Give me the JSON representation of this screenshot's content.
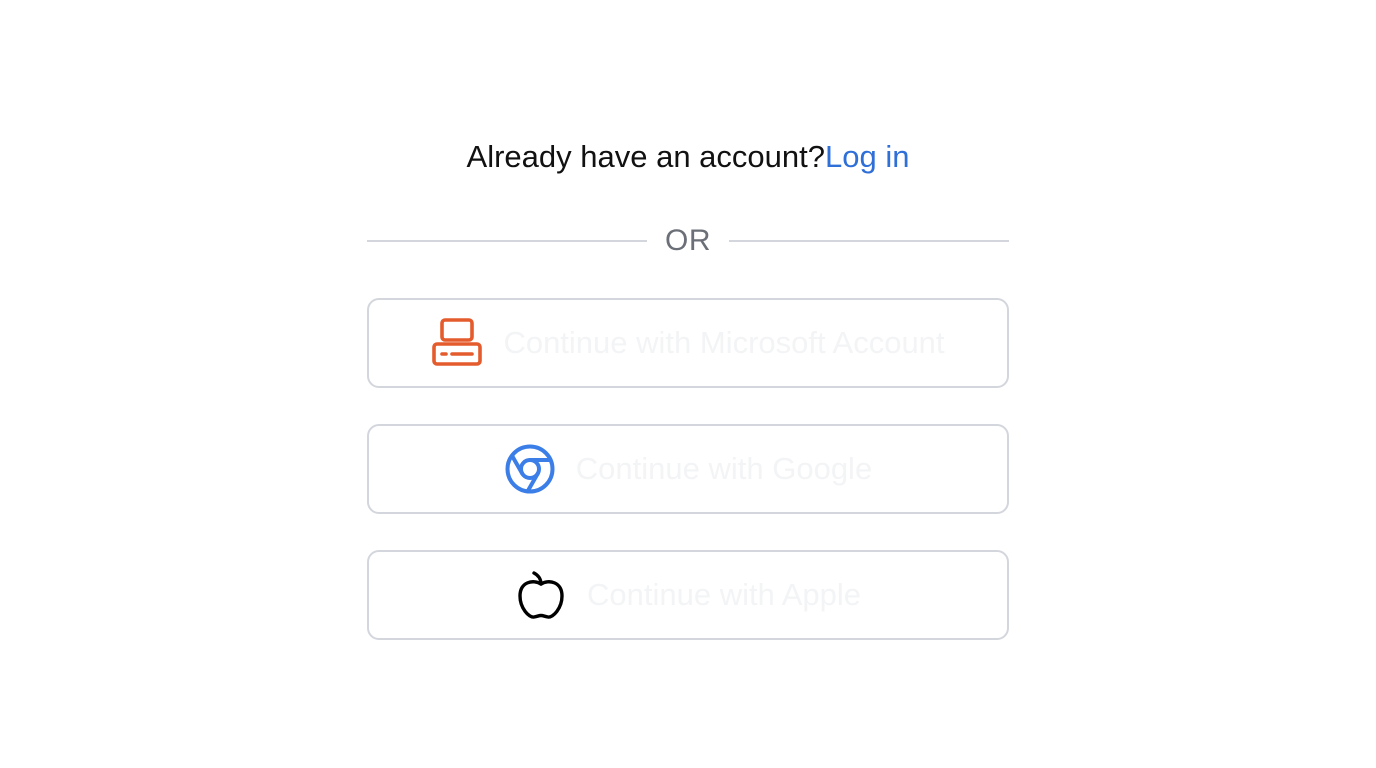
{
  "prompt": {
    "text": "Already have an account?",
    "link_label": "Log in"
  },
  "divider": {
    "label": "OR"
  },
  "buttons": [
    {
      "label": "Continue with Microsoft Account",
      "icon": "microsoft-device-icon",
      "icon_color": "#e45b2d"
    },
    {
      "label": "Continue with Google",
      "icon": "chrome-icon",
      "icon_color": "#3b7ee8"
    },
    {
      "label": "Continue with Apple",
      "icon": "apple-icon",
      "icon_color": "#000000"
    }
  ],
  "colors": {
    "link": "#2f6fd8",
    "border": "#d4d6dd",
    "button_text": "#f3f4f6"
  }
}
